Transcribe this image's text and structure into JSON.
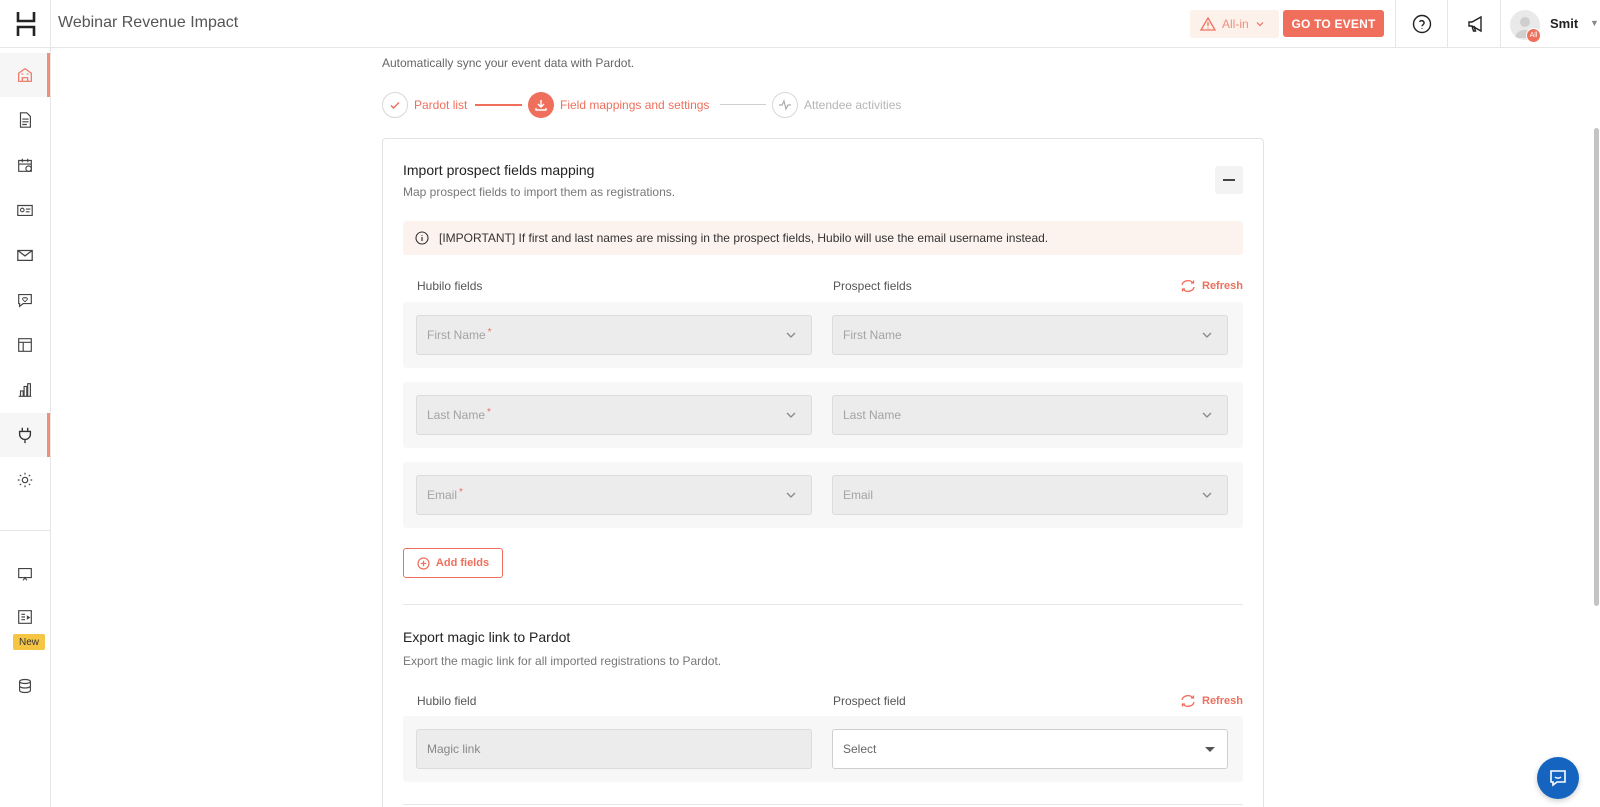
{
  "header": {
    "title": "Webinar Revenue Impact",
    "plan_label": "All-in",
    "go_to_event": "GO TO EVENT",
    "user_name": "Smit",
    "avatar_badge": "All"
  },
  "sidebar": {
    "new_badge": "New",
    "accent_color": "#f08f7c"
  },
  "page": {
    "subtitle": "Automatically sync your event data with Pardot."
  },
  "stepper": {
    "steps": [
      {
        "label": "Pardot list",
        "state": "done"
      },
      {
        "label": "Field mappings and settings",
        "state": "active"
      },
      {
        "label": "Attendee activities",
        "state": "pending"
      }
    ]
  },
  "import_section": {
    "title": "Import prospect fields mapping",
    "description": "Map prospect fields to import them as registrations.",
    "notice": "[IMPORTANT] If first and last names are missing in the prospect fields, Hubilo will use the email username instead.",
    "hubilo_header": "Hubilo fields",
    "prospect_header": "Prospect fields",
    "refresh_label": "Refresh",
    "rows": [
      {
        "hubilo": "First Name",
        "required": "*",
        "prospect": "First Name"
      },
      {
        "hubilo": "Last Name",
        "required": "*",
        "prospect": "Last Name"
      },
      {
        "hubilo": "Email",
        "required": "*",
        "prospect": "Email"
      }
    ],
    "add_fields": "Add fields"
  },
  "export_section": {
    "title": "Export magic link to Pardot",
    "description": "Export the magic link for all imported registrations to Pardot.",
    "hubilo_header": "Hubilo field",
    "prospect_header": "Prospect field",
    "refresh_label": "Refresh",
    "hubilo_value": "Magic link",
    "prospect_placeholder": "Select"
  },
  "colors": {
    "brand": "#ef6f5c",
    "notice_bg": "#fdf3ee",
    "chat": "#1565c0"
  }
}
